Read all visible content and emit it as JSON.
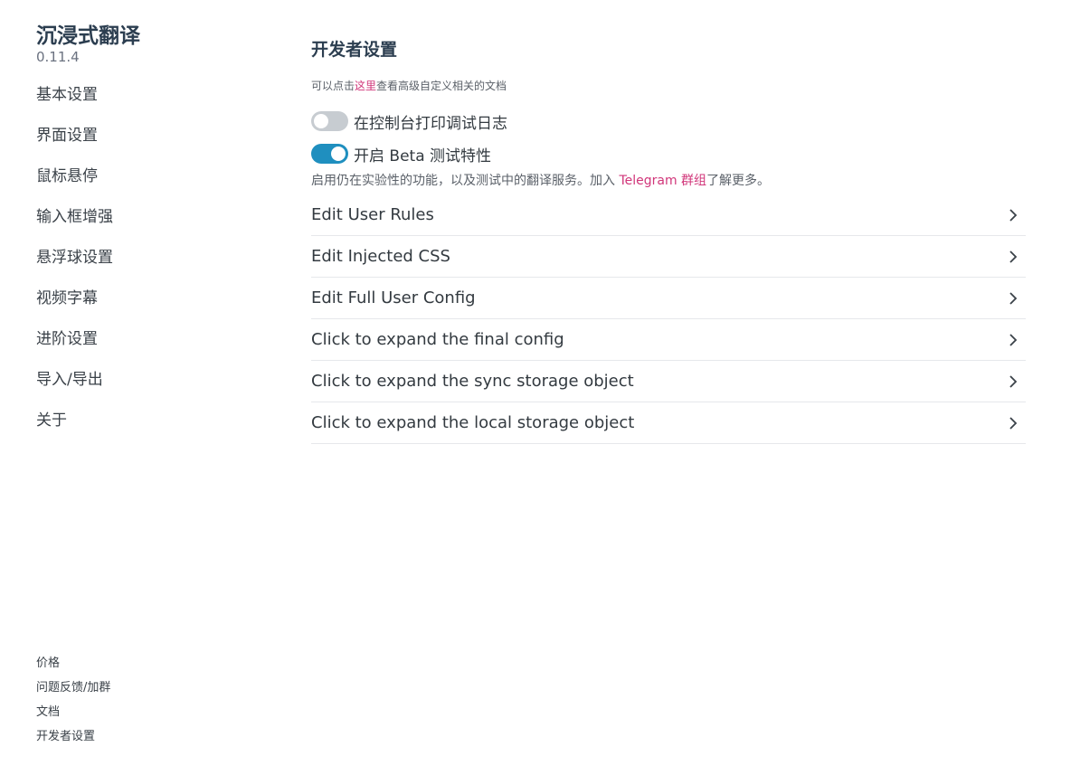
{
  "sidebar": {
    "app_name": "沉浸式翻译",
    "version": "0.11.4",
    "nav_items": [
      {
        "label": "基本设置"
      },
      {
        "label": "界面设置"
      },
      {
        "label": "鼠标悬停"
      },
      {
        "label": "输入框增强"
      },
      {
        "label": "悬浮球设置"
      },
      {
        "label": "视频字幕"
      },
      {
        "label": "进阶设置"
      },
      {
        "label": "导入/导出"
      },
      {
        "label": "关于"
      }
    ],
    "footer_links": [
      {
        "label": "价格"
      },
      {
        "label": "问题反馈/加群"
      },
      {
        "label": "文档"
      },
      {
        "label": "开发者设置"
      }
    ]
  },
  "main": {
    "title": "开发者设置",
    "help": {
      "prefix": "可以点击",
      "link": "这里",
      "suffix": "查看高级自定义相关的文档"
    },
    "toggles": [
      {
        "label": "在控制台打印调试日志",
        "enabled": false
      },
      {
        "label": "开启 Beta 测试特性",
        "enabled": true
      }
    ],
    "beta_desc": {
      "prefix": "启用仍在实验性的功能，以及测试中的翻译服务。加入 ",
      "link": "Telegram 群组",
      "suffix": "了解更多。"
    },
    "rows": [
      {
        "label": "Edit User Rules"
      },
      {
        "label": "Edit Injected CSS"
      },
      {
        "label": "Edit Full User Config"
      },
      {
        "label": "Click to expand the final config"
      },
      {
        "label": "Click to expand the sync storage object"
      },
      {
        "label": "Click to expand the local storage object"
      }
    ]
  },
  "icons": {
    "row_chevron": "chevron-right-icon"
  },
  "colors": {
    "accent_link": "#d1367a",
    "toggle_on": "#1f8fbf",
    "toggle_off": "#c7ccd1"
  }
}
